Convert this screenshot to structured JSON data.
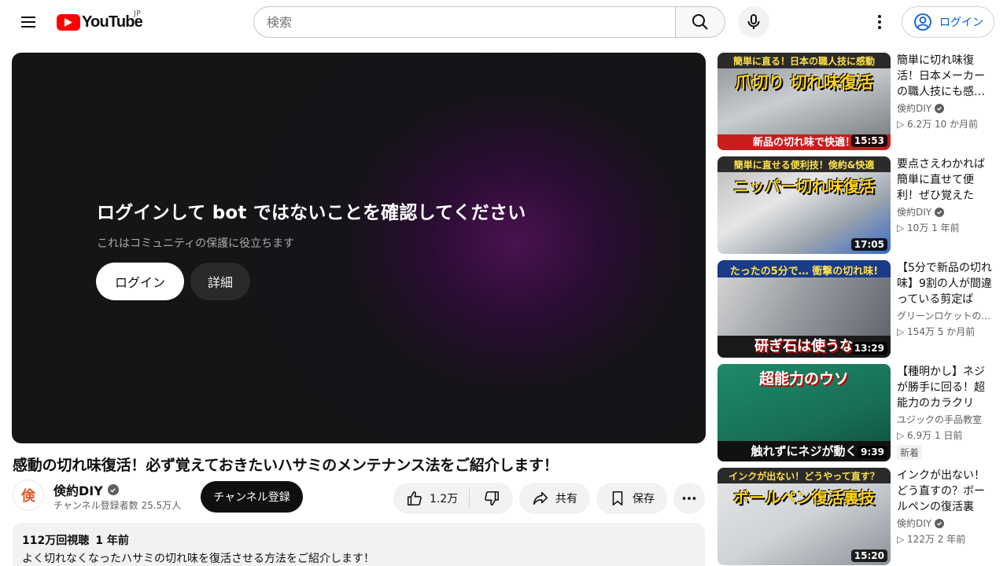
{
  "header": {
    "logo_text": "YouTube",
    "region": "JP",
    "search_placeholder": "検索",
    "login_label": "ログイン",
    "icons": [
      "menu-icon",
      "search-icon",
      "mic-icon",
      "more-vert-icon",
      "account-icon"
    ]
  },
  "player": {
    "heading": "ログインして bot ではないことを確認してください",
    "subtext": "これはコミュニティの保護に役立ちます",
    "login_label": "ログイン",
    "details_label": "詳細"
  },
  "video": {
    "title": "感動の切れ味復活！必ず覚えておきたいハサミのメンテナンス法をご紹介します！",
    "channel": "倹約DIY",
    "channel_avatar_char": "倹",
    "subscribers": "チャンネル登録者数 25.5万人",
    "subscribe_label": "チャンネル登録",
    "like_count": "1.2万",
    "share_label": "共有",
    "save_label": "保存",
    "views": "112万回視聴",
    "uploaded": "1 年前",
    "description": "よく切れなくなったハサミの切れ味を復活させる方法をご紹介します！"
  },
  "sidebar": [
    {
      "title": "簡単に切れ味復活！日本メーカーの職人技にも感…",
      "channel": "倹約DIY",
      "verified": true,
      "stats": "▷ 6.2万  10 か月前",
      "duration": "15:53",
      "thumb_top": "簡単に直る！日本の職人技に感動",
      "thumb_main": "爪切り 切れ味復活",
      "thumb_bottom": "新品の切れ味で快適！",
      "badge": ""
    },
    {
      "title": "要点さえわかれば簡単に直せて便利！ぜひ覚えたい…",
      "channel": "倹約DIY",
      "verified": true,
      "stats": "▷ 10万  1 年前",
      "duration": "17:05",
      "thumb_top": "簡単に直せる便利技！倹約&快適",
      "thumb_main": "ニッパー切れ味復活",
      "thumb_bottom": "",
      "badge": ""
    },
    {
      "title": "【5分で新品の切れ味】9割の人が間違っている剪定ばさ…",
      "channel": "グリーンロケットの…",
      "verified": false,
      "stats": "▷ 154万  5 か月前",
      "duration": "13:29",
      "thumb_top": "たったの5分で… 衝撃の切れ味!",
      "thumb_main": "",
      "thumb_bottom": "研ぎ石は使うな",
      "badge": ""
    },
    {
      "title": "【種明かし】ネジが勝手に回る！超能力のカラクリを…",
      "channel": "ユジックの手品教室",
      "verified": false,
      "stats": "▷ 6.9万  1 日前",
      "duration": "9:39",
      "thumb_top": "超能力のウソ",
      "thumb_main": "",
      "thumb_bottom": "触れずにネジが動く",
      "badge": "新着"
    },
    {
      "title": "インクが出ない！どう直すの？ボールペンの復活裏技…",
      "channel": "倹約DIY",
      "verified": true,
      "stats": "▷ 122万  2 年前",
      "duration": "15:20",
      "thumb_top": "インクが出ない！どうやって直す？",
      "thumb_main": "ボールペン復活裏技",
      "thumb_bottom": "",
      "badge": ""
    }
  ]
}
